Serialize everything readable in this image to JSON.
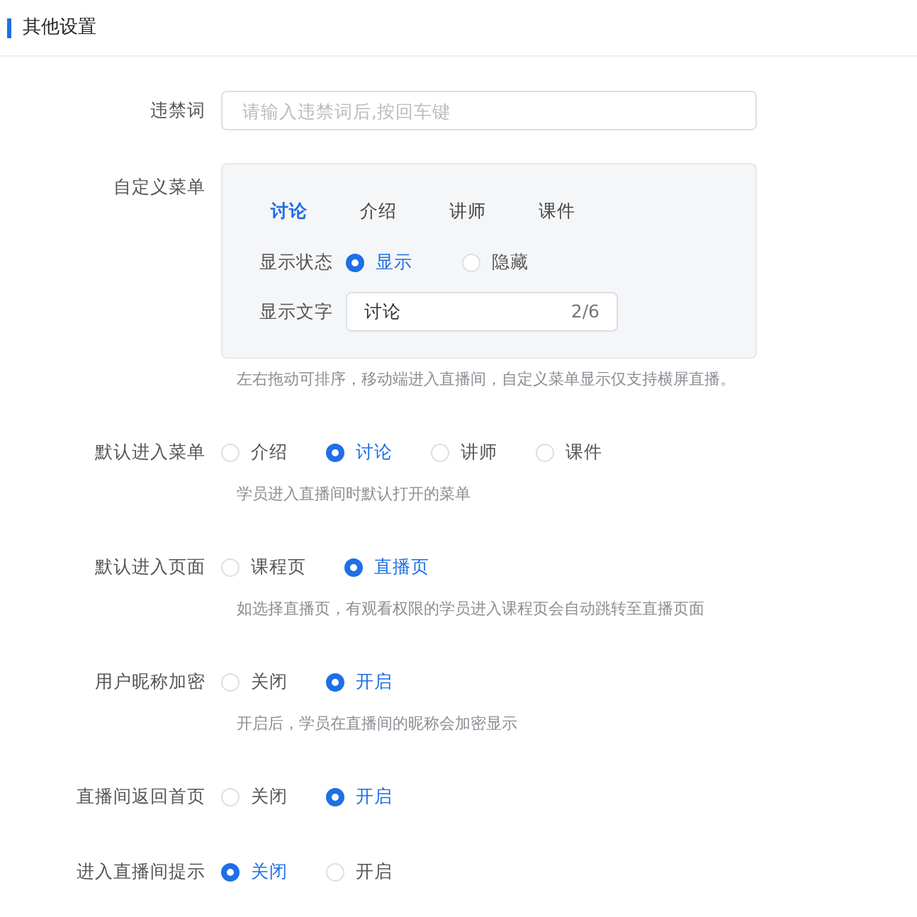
{
  "section_title": "其他设置",
  "settings": [
    {
      "kind": "input",
      "label": "违禁词",
      "placeholder": "请输入违禁词后,按回车键"
    },
    {
      "kind": "custom_menu",
      "label": "自定义菜单",
      "hint": "左右拖动可排序，移动端进入直播间，自定义菜单显示仅支持横屏直播。",
      "tabs": [
        {
          "label": "讨论",
          "selected": true
        },
        {
          "label": "介绍",
          "selected": false
        },
        {
          "label": "讲师",
          "selected": false
        },
        {
          "label": "课件",
          "selected": false
        }
      ],
      "status_label": "显示状态",
      "status_options": [
        {
          "label": "显示",
          "selected": true
        },
        {
          "label": "隐藏",
          "selected": false
        }
      ],
      "text_label": "显示文字",
      "text_value": "讨论",
      "text_count": "2/6"
    },
    {
      "kind": "radio",
      "label": "默认进入菜单",
      "hint": "学员进入直播间时默认打开的菜单",
      "options": [
        {
          "label": "介绍",
          "selected": false
        },
        {
          "label": "讨论",
          "selected": true
        },
        {
          "label": "讲师",
          "selected": false
        },
        {
          "label": "课件",
          "selected": false
        }
      ]
    },
    {
      "kind": "radio",
      "label": "默认进入页面",
      "hint": "如选择直播页，有观看权限的学员进入课程页会自动跳转至直播页面",
      "options": [
        {
          "label": "课程页",
          "selected": false
        },
        {
          "label": "直播页",
          "selected": true
        }
      ]
    },
    {
      "kind": "radio",
      "label": "用户昵称加密",
      "hint": "开启后，学员在直播间的昵称会加密显示",
      "options": [
        {
          "label": "关闭",
          "selected": false
        },
        {
          "label": "开启",
          "selected": true
        }
      ]
    },
    {
      "kind": "radio",
      "label": "直播间返回首页",
      "options": [
        {
          "label": "关闭",
          "selected": false
        },
        {
          "label": "开启",
          "selected": true
        }
      ]
    },
    {
      "kind": "radio",
      "label": "进入直播间提示",
      "options": [
        {
          "label": "关闭",
          "selected": true
        },
        {
          "label": "开启",
          "selected": false
        }
      ]
    }
  ]
}
